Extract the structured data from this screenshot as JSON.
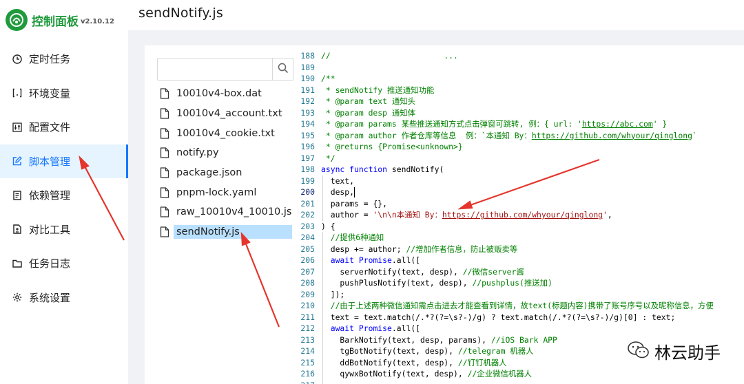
{
  "app": {
    "title": "控制面板",
    "version": "v2.10.12",
    "page_title": "sendNotify.js"
  },
  "sidebar": {
    "items": [
      {
        "label": "定时任务",
        "icon": "clock-icon"
      },
      {
        "label": "环境变量",
        "icon": "variable-icon"
      },
      {
        "label": "配置文件",
        "icon": "sliders-icon"
      },
      {
        "label": "脚本管理",
        "icon": "edit-icon",
        "active": true
      },
      {
        "label": "依赖管理",
        "icon": "package-icon"
      },
      {
        "label": "对比工具",
        "icon": "diff-icon"
      },
      {
        "label": "任务日志",
        "icon": "folder-icon"
      },
      {
        "label": "系统设置",
        "icon": "gear-icon"
      }
    ]
  },
  "search": {
    "value": "",
    "placeholder": ""
  },
  "files": [
    {
      "name": "10010v4-box.dat"
    },
    {
      "name": "10010v4_account.txt"
    },
    {
      "name": "10010v4_cookie.txt"
    },
    {
      "name": "notify.py"
    },
    {
      "name": "package.json"
    },
    {
      "name": "pnpm-lock.yaml"
    },
    {
      "name": "raw_10010v4_10010.js"
    },
    {
      "name": "sendNotify.js",
      "selected": true
    }
  ],
  "editor": {
    "top_partial": "//                        ...            ",
    "lines": [
      {
        "n": "189",
        "t": ""
      },
      {
        "n": "190",
        "t": "/**"
      },
      {
        "n": "191",
        "t": " * sendNotify 推送通知功能"
      },
      {
        "n": "192",
        "t": " * @param text 通知头"
      },
      {
        "n": "193",
        "t": " * @param desp 通知体"
      },
      {
        "n": "194",
        "t": " * @param params 某些推送通知方式点击弹窗可跳转, 例：{ url: 'https://abc.com' }"
      },
      {
        "n": "195",
        "t": " * @param author 作者仓库等信息  例：`本通知 By：https://github.com/whyour/qinglong`"
      },
      {
        "n": "196",
        "t": " * @returns {Promise<unknown>}"
      },
      {
        "n": "197",
        "t": " */"
      },
      {
        "n": "198",
        "t": "async function sendNotify("
      },
      {
        "n": "199",
        "t": "  text,"
      },
      {
        "n": "200",
        "t": "  desp,"
      },
      {
        "n": "201",
        "t": "  params = {},"
      },
      {
        "n": "202",
        "t": "  author = '\\n\\n本通知 By：https://github.com/whyour/qinglong',"
      },
      {
        "n": "203",
        "t": ") {"
      },
      {
        "n": "204",
        "t": "  //提供6种通知"
      },
      {
        "n": "205",
        "t": "  desp += author; //增加作者信息，防止被贩卖等"
      },
      {
        "n": "206",
        "t": "  await Promise.all(["
      },
      {
        "n": "207",
        "t": "    serverNotify(text, desp), //微信server酱"
      },
      {
        "n": "208",
        "t": "    pushPlusNotify(text, desp), //pushplus(推送加)"
      },
      {
        "n": "209",
        "t": "  ]);"
      },
      {
        "n": "210",
        "t": "  //由于上述两种微信通知需点击进去才能查看到详情，故text(标题内容)携带了账号序号以及昵称信息，方便"
      },
      {
        "n": "211",
        "t": "  text = text.match(/.*?(?=\\s?-)/g) ? text.match(/.*?(?=\\s?-)/g)[0] : text;"
      },
      {
        "n": "212",
        "t": "  await Promise.all(["
      },
      {
        "n": "213",
        "t": "    BarkNotify(text, desp, params), //iOS Bark APP"
      },
      {
        "n": "214",
        "t": "    tgBotNotify(text, desp), //telegram 机器人"
      },
      {
        "n": "215",
        "t": "    ddBotNotify(text, desp), //钉钉机器人"
      },
      {
        "n": "216",
        "t": "    qywxBotNotify(text, desp), //企业微信机器人"
      },
      {
        "n": "217",
        "t": "    ..."
      }
    ]
  },
  "watermark": {
    "text": "林云助手"
  },
  "colors": {
    "brand": "#1f9a3c",
    "accent": "#1677ff",
    "annotation_arrow": "#e5352c"
  }
}
